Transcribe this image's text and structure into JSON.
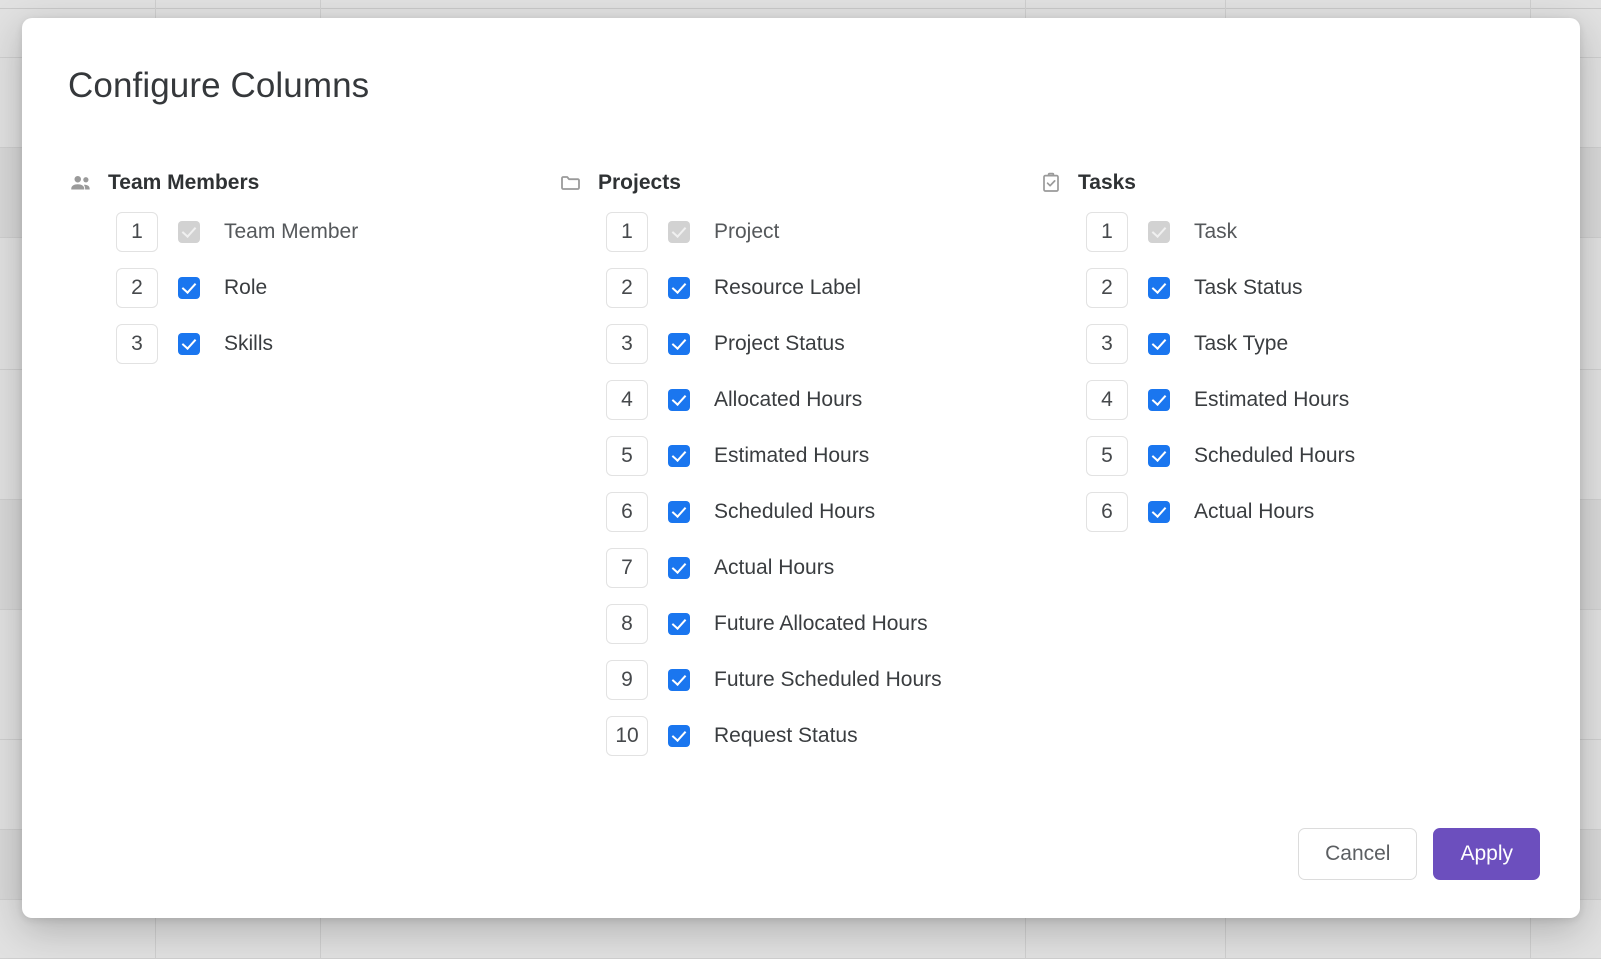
{
  "backdrop": {
    "description": "dimmed-table-behind-modal",
    "row_count": 10,
    "column_divider_positions": [
      155,
      320,
      1025,
      1225,
      1530
    ]
  },
  "modal": {
    "title": "Configure Columns",
    "groups": [
      {
        "id": "team-members",
        "title": "Team Members",
        "icon": "people-icon",
        "items": [
          {
            "order": "1",
            "label": "Team Member",
            "checked": true,
            "disabled": true
          },
          {
            "order": "2",
            "label": "Role",
            "checked": true,
            "disabled": false
          },
          {
            "order": "3",
            "label": "Skills",
            "checked": true,
            "disabled": false
          }
        ]
      },
      {
        "id": "projects",
        "title": "Projects",
        "icon": "folder-icon",
        "items": [
          {
            "order": "1",
            "label": "Project",
            "checked": true,
            "disabled": true
          },
          {
            "order": "2",
            "label": "Resource Label",
            "checked": true,
            "disabled": false
          },
          {
            "order": "3",
            "label": "Project Status",
            "checked": true,
            "disabled": false
          },
          {
            "order": "4",
            "label": "Allocated Hours",
            "checked": true,
            "disabled": false
          },
          {
            "order": "5",
            "label": "Estimated Hours",
            "checked": true,
            "disabled": false
          },
          {
            "order": "6",
            "label": "Scheduled Hours",
            "checked": true,
            "disabled": false
          },
          {
            "order": "7",
            "label": "Actual Hours",
            "checked": true,
            "disabled": false
          },
          {
            "order": "8",
            "label": "Future Allocated Hours",
            "checked": true,
            "disabled": false
          },
          {
            "order": "9",
            "label": "Future Scheduled Hours",
            "checked": true,
            "disabled": false,
            "wrap": true
          },
          {
            "order": "10",
            "label": "Request Status",
            "checked": true,
            "disabled": false
          }
        ]
      },
      {
        "id": "tasks",
        "title": "Tasks",
        "icon": "clipboard-check-icon",
        "items": [
          {
            "order": "1",
            "label": "Task",
            "checked": true,
            "disabled": true
          },
          {
            "order": "2",
            "label": "Task Status",
            "checked": true,
            "disabled": false
          },
          {
            "order": "3",
            "label": "Task Type",
            "checked": true,
            "disabled": false
          },
          {
            "order": "4",
            "label": "Estimated Hours",
            "checked": true,
            "disabled": false
          },
          {
            "order": "5",
            "label": "Scheduled Hours",
            "checked": true,
            "disabled": false
          },
          {
            "order": "6",
            "label": "Actual Hours",
            "checked": true,
            "disabled": false
          }
        ]
      }
    ],
    "footer": {
      "cancel_label": "Cancel",
      "apply_label": "Apply"
    }
  },
  "colors": {
    "checkbox_checked": "#1a76ef",
    "checkbox_disabled": "#d2d2d2",
    "apply_button": "#6c4fbe",
    "modal_background": "#ffffff",
    "backdrop": "#e1e1e1",
    "title_text": "#35383b"
  }
}
